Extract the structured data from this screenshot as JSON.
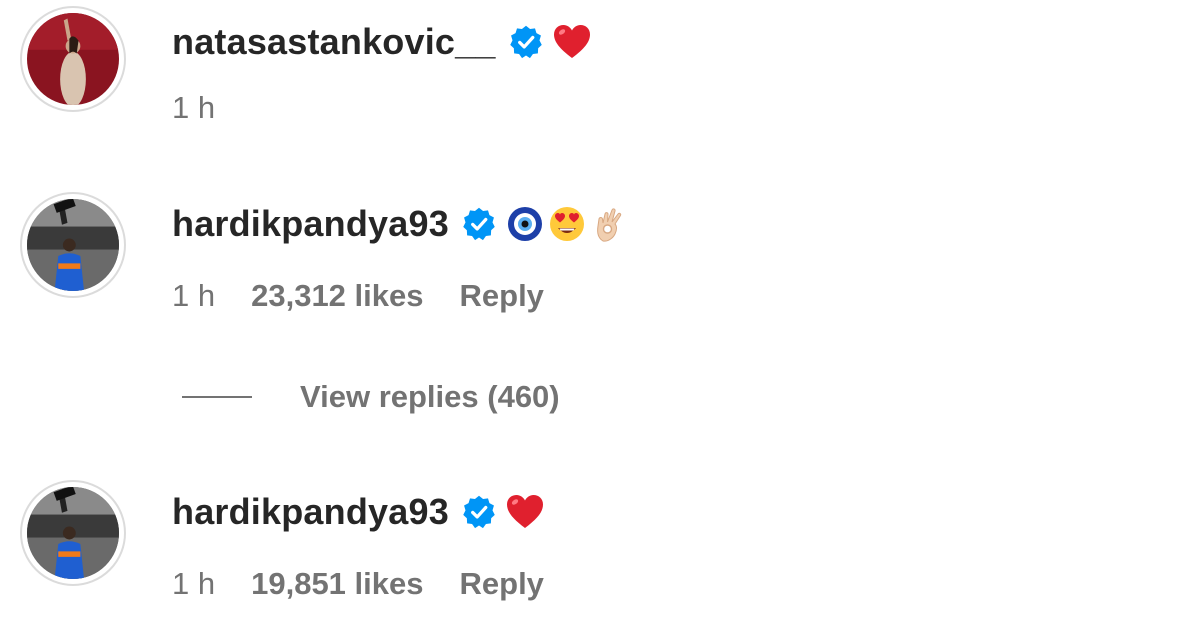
{
  "comments": [
    {
      "username": "natasastankovic__",
      "verified": true,
      "emojis": [
        "red-heart"
      ],
      "time": "1 h",
      "likes": "",
      "reply_label": ""
    },
    {
      "username": "hardikpandya93",
      "verified": true,
      "emojis": [
        "nazar-amulet",
        "heart-eyes-face",
        "ok-hand-light-skin"
      ],
      "time": "1 h",
      "likes": "23,312 likes",
      "reply_label": "Reply"
    },
    {
      "username": "hardikpandya93",
      "verified": true,
      "emojis": [
        "red-heart"
      ],
      "time": "1 h",
      "likes": "19,851 likes",
      "reply_label": "Reply"
    }
  ],
  "view_replies": {
    "label": "View replies (460)"
  },
  "colors": {
    "username": "#262626",
    "meta": "#737373",
    "verified_badge": "#0095f6",
    "avatar_border": "#dbdbdb"
  }
}
